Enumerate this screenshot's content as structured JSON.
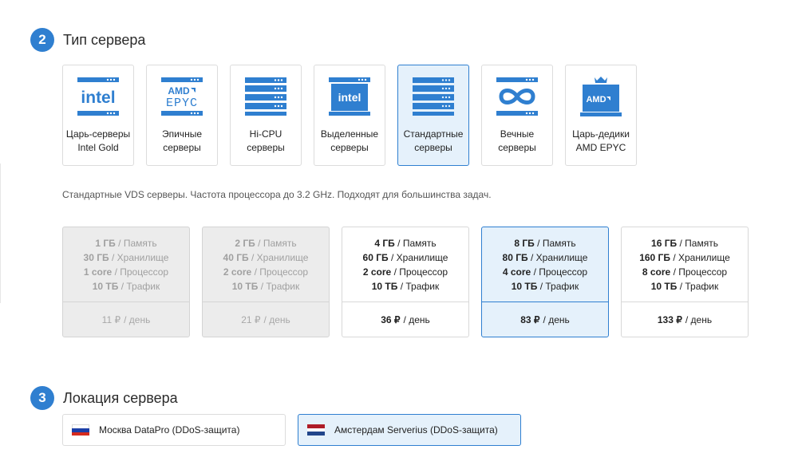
{
  "server_type": {
    "step": "2",
    "title": "Тип сервера",
    "options": [
      {
        "line1": "Царь-серверы",
        "line2": "Intel Gold",
        "icon": "intel-gold-icon",
        "selected": false
      },
      {
        "line1": "Эпичные",
        "line2": "серверы",
        "icon": "amd-epyc-icon",
        "selected": false
      },
      {
        "line1": "Hi-CPU",
        "line2": "серверы",
        "icon": "server-rack-icon",
        "selected": false
      },
      {
        "line1": "Выделенные",
        "line2": "серверы",
        "icon": "intel-dedicated-icon",
        "selected": false
      },
      {
        "line1": "Стандартные",
        "line2": "серверы",
        "icon": "server-rack-icon",
        "selected": true
      },
      {
        "line1": "Вечные",
        "line2": "серверы",
        "icon": "infinity-icon",
        "selected": false
      },
      {
        "line1": "Царь-дедики",
        "line2": "AMD EPYC",
        "icon": "amd-crown-icon",
        "selected": false
      }
    ],
    "icon_texts": {
      "intel": "intel",
      "amd": "AMD",
      "epyc": "EPYC"
    },
    "description": "Стандартные VDS серверы. Частота процессора до 3.2 GHz. Подходят для большинства задач."
  },
  "plans": [
    {
      "mem": "1 ГБ",
      "mem_l": " / Память",
      "disk": "30 ГБ",
      "disk_l": " / Хранилище",
      "cpu": "1 core",
      "cpu_l": " / Процессор",
      "traffic": "10 ТБ",
      "traffic_l": " / Трафик",
      "price": "11 ₽",
      "price_l": "/ день",
      "state": "disabled"
    },
    {
      "mem": "2 ГБ",
      "mem_l": " / Память",
      "disk": "40 ГБ",
      "disk_l": " / Хранилище",
      "cpu": "2 core",
      "cpu_l": " / Процессор",
      "traffic": "10 ТБ",
      "traffic_l": " / Трафик",
      "price": "21 ₽",
      "price_l": "/ день",
      "state": "disabled"
    },
    {
      "mem": "4 ГБ",
      "mem_l": " / Память",
      "disk": "60 ГБ",
      "disk_l": " / Хранилище",
      "cpu": "2 core",
      "cpu_l": " / Процессор",
      "traffic": "10 ТБ",
      "traffic_l": " / Трафик",
      "price": "36 ₽",
      "price_l": "/ день",
      "state": "normal"
    },
    {
      "mem": "8 ГБ",
      "mem_l": " / Память",
      "disk": "80 ГБ",
      "disk_l": " / Хранилище",
      "cpu": "4 core",
      "cpu_l": " / Процессор",
      "traffic": "10 ТБ",
      "traffic_l": " / Трафик",
      "price": "83 ₽",
      "price_l": "/ день",
      "state": "selected"
    },
    {
      "mem": "16 ГБ",
      "mem_l": " / Память",
      "disk": "160 ГБ",
      "disk_l": " / Хранилище",
      "cpu": "8 core",
      "cpu_l": " / Процессор",
      "traffic": "10 ТБ",
      "traffic_l": " / Трафик",
      "price": "133 ₽",
      "price_l": "/ день",
      "state": "normal"
    }
  ],
  "location": {
    "step": "3",
    "title": "Локация сервера",
    "options": [
      {
        "label": "Москва DataPro (DDoS-защита)",
        "flag": "russia-flag-icon",
        "selected": false
      },
      {
        "label": "Амстердам Serverius (DDoS-защита)",
        "flag": "netherlands-flag-icon",
        "selected": true
      }
    ]
  },
  "colors": {
    "accent": "#2f7fd0",
    "selected_bg": "#e5f1fb",
    "disabled_bg": "#ececec"
  }
}
